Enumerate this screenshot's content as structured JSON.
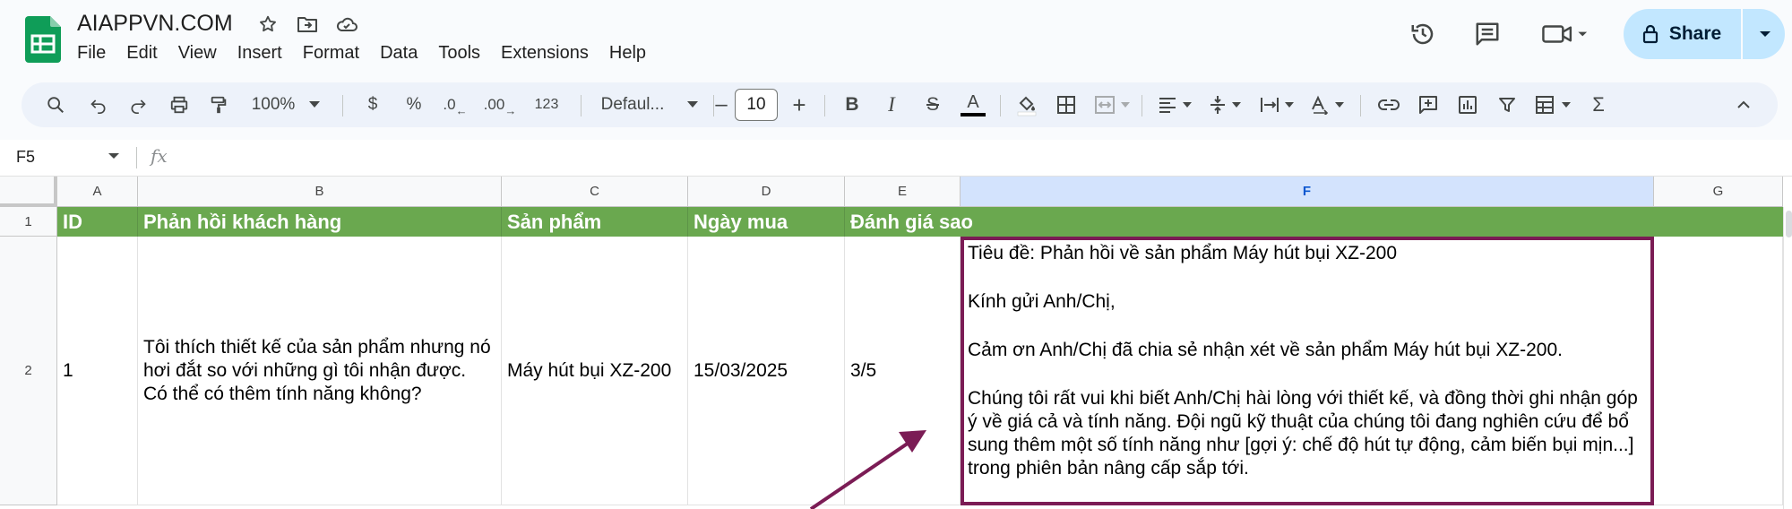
{
  "app": {
    "title": "AIAPPVN.COM",
    "accent": "#0f9d58"
  },
  "menu": [
    "File",
    "Edit",
    "View",
    "Insert",
    "Format",
    "Data",
    "Tools",
    "Extensions",
    "Help"
  ],
  "share": {
    "label": "Share",
    "bg": "#c2e7ff"
  },
  "toolbar": {
    "zoom": "100%",
    "currency": "$",
    "percent": "%",
    "dec_decrease": ".0",
    "dec_increase": ".00",
    "number_format": "123",
    "font": "Defaul...",
    "font_size": "10",
    "minus": "–",
    "plus": "+",
    "bold": "B",
    "italic": "I",
    "strike": "S",
    "text_color": "A",
    "sigma": "Σ"
  },
  "formula_bar": {
    "name_box": "F5",
    "fx": "fx",
    "value": ""
  },
  "sheet": {
    "columns": [
      "A",
      "B",
      "C",
      "D",
      "E",
      "F",
      "G"
    ],
    "selected_column": "F",
    "rows": [
      "1",
      "2"
    ],
    "header_bg": "#6aa84f",
    "headers": [
      "ID",
      "Phản hồi khách hàng",
      "Sản phẩm",
      "Ngày mua",
      "Đánh giá sao"
    ],
    "row2": {
      "id": "1",
      "feedback": "Tôi thích thiết kế của sản phẩm nhưng nó hơi đắt so với những gì tôi nhận được. Có thể có thêm tính năng không?",
      "product": "Máy hút bụi XZ-200",
      "date": "15/03/2025",
      "rating": "3/5",
      "response": [
        "Tiêu đề: Phản hồi về sản phẩm Máy hút bụi XZ-200",
        "Kính gửi Anh/Chị,",
        "Cảm ơn Anh/Chị đã chia sẻ nhận xét về sản phẩm Máy hút bụi XZ-200.",
        "Chúng tôi rất vui khi biết Anh/Chị hài lòng với thiết kế, và đồng thời ghi nhận góp ý về giá cả và tính năng. Đội ngũ kỹ thuật của chúng tôi đang nghiên cứu để bổ sung thêm một số tính năng như [gợi ý: chế độ hút tự động, cảm biến bụi mịn...] trong phiên bản nâng cấp sắp tới."
      ]
    },
    "highlight_color": "#7b1c55"
  }
}
